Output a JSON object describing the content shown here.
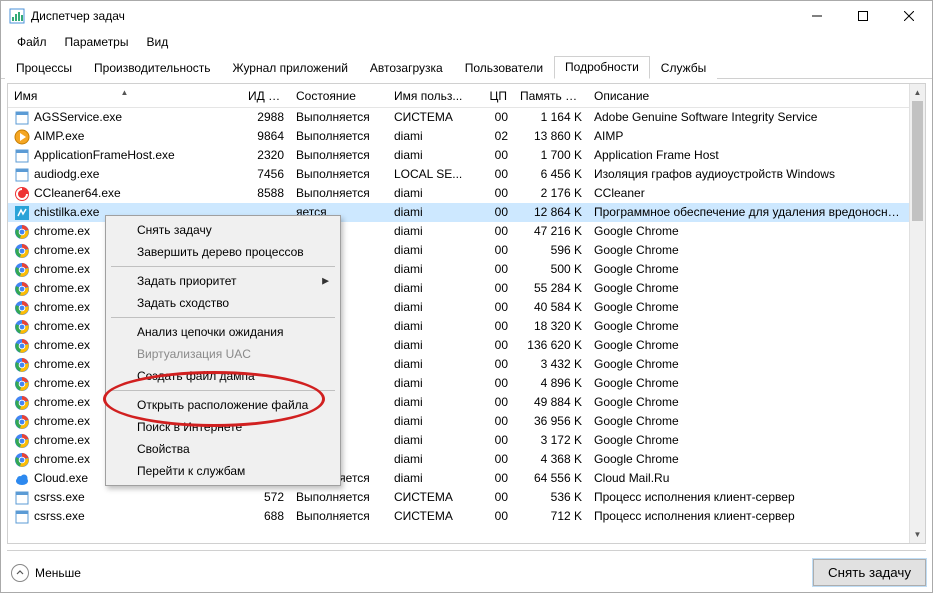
{
  "window": {
    "title": "Диспетчер задач"
  },
  "menubar": [
    "Файл",
    "Параметры",
    "Вид"
  ],
  "tabs": [
    {
      "label": "Процессы",
      "active": false
    },
    {
      "label": "Производительность",
      "active": false
    },
    {
      "label": "Журнал приложений",
      "active": false
    },
    {
      "label": "Автозагрузка",
      "active": false
    },
    {
      "label": "Пользователи",
      "active": false
    },
    {
      "label": "Подробности",
      "active": true
    },
    {
      "label": "Службы",
      "active": false
    }
  ],
  "columns": {
    "name": "Имя",
    "pid": "ИД п...",
    "state": "Состояние",
    "user": "Имя польз...",
    "cpu": "ЦП",
    "mem": "Память (ч...",
    "desc": "Описание"
  },
  "sort_column": "name",
  "sort_dir": "asc",
  "processes": [
    {
      "icon": "generic",
      "name": "AGSService.exe",
      "pid": "2988",
      "state": "Выполняется",
      "user": "СИСТЕМА",
      "cpu": "00",
      "mem": "1 164 K",
      "desc": "Adobe Genuine Software Integrity Service"
    },
    {
      "icon": "aimp",
      "name": "AIMP.exe",
      "pid": "9864",
      "state": "Выполняется",
      "user": "diami",
      "cpu": "02",
      "mem": "13 860 K",
      "desc": "AIMP"
    },
    {
      "icon": "generic",
      "name": "ApplicationFrameHost.exe",
      "pid": "2320",
      "state": "Выполняется",
      "user": "diami",
      "cpu": "00",
      "mem": "1 700 K",
      "desc": "Application Frame Host"
    },
    {
      "icon": "generic",
      "name": "audiodg.exe",
      "pid": "7456",
      "state": "Выполняется",
      "user": "LOCAL SE...",
      "cpu": "00",
      "mem": "6 456 K",
      "desc": "Изоляция графов аудиоустройств Windows"
    },
    {
      "icon": "ccleaner",
      "name": "CCleaner64.exe",
      "pid": "8588",
      "state": "Выполняется",
      "user": "diami",
      "cpu": "00",
      "mem": "2 176 K",
      "desc": "CCleaner"
    },
    {
      "icon": "chistilka",
      "name": "chistilka.exe",
      "pid": "",
      "state": "яется",
      "user": "diami",
      "cpu": "00",
      "mem": "12 864 K",
      "desc": "Программное обеспечение для удаления вредоносных ф",
      "selected": true
    },
    {
      "icon": "chrome",
      "name": "chrome.ex",
      "pid": "",
      "state": "яется",
      "user": "diami",
      "cpu": "00",
      "mem": "47 216 K",
      "desc": "Google Chrome"
    },
    {
      "icon": "chrome",
      "name": "chrome.ex",
      "pid": "",
      "state": "яется",
      "user": "diami",
      "cpu": "00",
      "mem": "596 K",
      "desc": "Google Chrome"
    },
    {
      "icon": "chrome",
      "name": "chrome.ex",
      "pid": "",
      "state": "яется",
      "user": "diami",
      "cpu": "00",
      "mem": "500 K",
      "desc": "Google Chrome"
    },
    {
      "icon": "chrome",
      "name": "chrome.ex",
      "pid": "",
      "state": "яется",
      "user": "diami",
      "cpu": "00",
      "mem": "55 284 K",
      "desc": "Google Chrome"
    },
    {
      "icon": "chrome",
      "name": "chrome.ex",
      "pid": "",
      "state": "яется",
      "user": "diami",
      "cpu": "00",
      "mem": "40 584 K",
      "desc": "Google Chrome"
    },
    {
      "icon": "chrome",
      "name": "chrome.ex",
      "pid": "",
      "state": "яется",
      "user": "diami",
      "cpu": "00",
      "mem": "18 320 K",
      "desc": "Google Chrome"
    },
    {
      "icon": "chrome",
      "name": "chrome.ex",
      "pid": "",
      "state": "яется",
      "user": "diami",
      "cpu": "00",
      "mem": "136 620 K",
      "desc": "Google Chrome"
    },
    {
      "icon": "chrome",
      "name": "chrome.ex",
      "pid": "",
      "state": "яется",
      "user": "diami",
      "cpu": "00",
      "mem": "3 432 K",
      "desc": "Google Chrome"
    },
    {
      "icon": "chrome",
      "name": "chrome.ex",
      "pid": "",
      "state": "яется",
      "user": "diami",
      "cpu": "00",
      "mem": "4 896 K",
      "desc": "Google Chrome"
    },
    {
      "icon": "chrome",
      "name": "chrome.ex",
      "pid": "",
      "state": "яется",
      "user": "diami",
      "cpu": "00",
      "mem": "49 884 K",
      "desc": "Google Chrome"
    },
    {
      "icon": "chrome",
      "name": "chrome.ex",
      "pid": "",
      "state": "яется",
      "user": "diami",
      "cpu": "00",
      "mem": "36 956 K",
      "desc": "Google Chrome"
    },
    {
      "icon": "chrome",
      "name": "chrome.ex",
      "pid": "",
      "state": "яется",
      "user": "diami",
      "cpu": "00",
      "mem": "3 172 K",
      "desc": "Google Chrome"
    },
    {
      "icon": "chrome",
      "name": "chrome.ex",
      "pid": "",
      "state": "яется",
      "user": "diami",
      "cpu": "00",
      "mem": "4 368 K",
      "desc": "Google Chrome"
    },
    {
      "icon": "cloud",
      "name": "Cloud.exe",
      "pid": "8932",
      "state": "Выполняется",
      "user": "diami",
      "cpu": "00",
      "mem": "64 556 K",
      "desc": "Cloud Mail.Ru"
    },
    {
      "icon": "generic",
      "name": "csrss.exe",
      "pid": "572",
      "state": "Выполняется",
      "user": "СИСТЕМА",
      "cpu": "00",
      "mem": "536 K",
      "desc": "Процесс исполнения клиент-сервер"
    },
    {
      "icon": "generic",
      "name": "csrss.exe",
      "pid": "688",
      "state": "Выполняется",
      "user": "СИСТЕМА",
      "cpu": "00",
      "mem": "712 K",
      "desc": "Процесс исполнения клиент-сервер"
    }
  ],
  "context_menu": [
    {
      "label": "Снять задачу",
      "type": "item"
    },
    {
      "label": "Завершить дерево процессов",
      "type": "item"
    },
    {
      "type": "sep"
    },
    {
      "label": "Задать приоритет",
      "type": "submenu"
    },
    {
      "label": "Задать сходство",
      "type": "item"
    },
    {
      "type": "sep"
    },
    {
      "label": "Анализ цепочки ожидания",
      "type": "item"
    },
    {
      "label": "Виртуализация UAC",
      "type": "item",
      "disabled": true
    },
    {
      "label": "Создать файл дампа",
      "type": "item"
    },
    {
      "type": "sep"
    },
    {
      "label": "Открыть расположение файла",
      "type": "item"
    },
    {
      "label": "Поиск в Интернете",
      "type": "item"
    },
    {
      "label": "Свойства",
      "type": "item"
    },
    {
      "label": "Перейти к службам",
      "type": "item"
    }
  ],
  "bottom": {
    "fewer": "Меньше",
    "end_task": "Снять задачу"
  }
}
